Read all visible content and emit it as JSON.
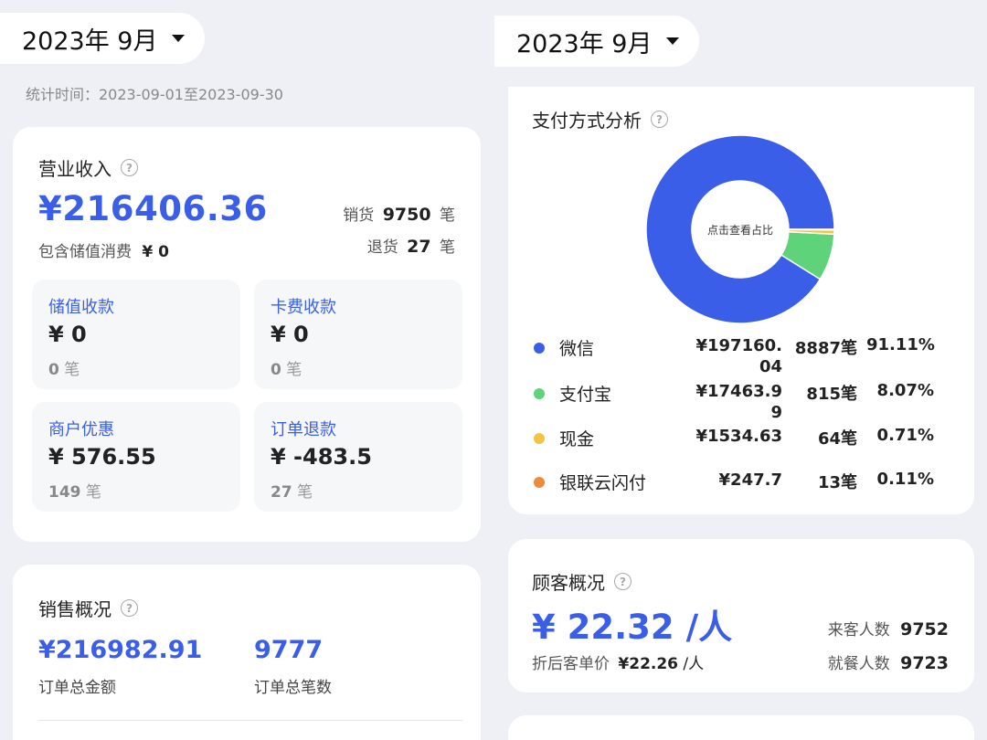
{
  "left_month": {
    "label": "2023年 9月"
  },
  "right_month": {
    "label": "2023年 9月"
  },
  "period": "统计时间：2023-09-01至2023-09-30",
  "revenue": {
    "title": "营业收入",
    "amount": "¥216406.36",
    "stored_label": "包含储值消费",
    "stored_value": "¥ 0",
    "sales_label": "销货",
    "sales_count": "9750",
    "refund_label": "退货",
    "refund_count": "27",
    "unit": "笔",
    "cards": [
      {
        "title": "储值收款",
        "value": "¥ 0",
        "count": "0",
        "unit": "笔"
      },
      {
        "title": "卡费收款",
        "value": "¥ 0",
        "count": "0",
        "unit": "笔"
      },
      {
        "title": "商户优惠",
        "value": "¥ 576.55",
        "count": "149",
        "unit": "笔"
      },
      {
        "title": "订单退款",
        "value": "¥ -483.5",
        "count": "27",
        "unit": "笔"
      }
    ]
  },
  "sales_overview": {
    "title": "销售概况",
    "total_amount": "¥216982.91",
    "total_amount_label": "订单总金额",
    "total_orders": "9777",
    "total_orders_label": "订单总笔数"
  },
  "payment": {
    "title": "支付方式分析",
    "center_text": "点击查看占比",
    "colors": {
      "wechat": "#3b5ee8",
      "alipay": "#5fd37a",
      "cash": "#f5c343",
      "unionpay": "#ee8a3a"
    },
    "rows": [
      {
        "name": "微信",
        "amount_l1": "¥197160.",
        "amount_l2": "04",
        "count": "8887笔",
        "pct": "91.11%",
        "color": "#3b5ee8"
      },
      {
        "name": "支付宝",
        "amount_l1": "¥17463.9",
        "amount_l2": "9",
        "count": "815笔",
        "pct": "8.07%",
        "color": "#5fd37a"
      },
      {
        "name": "现金",
        "amount_l1": "¥1534.63",
        "amount_l2": "",
        "count": "64笔",
        "pct": "0.71%",
        "color": "#f5c343"
      },
      {
        "name": "银联云闪付",
        "amount_l1": "¥247.7",
        "amount_l2": "",
        "count": "13笔",
        "pct": "0.11%",
        "color": "#ee8a3a"
      }
    ]
  },
  "chart_data": {
    "type": "pie",
    "categories": [
      "微信",
      "支付宝",
      "现金",
      "银联云闪付"
    ],
    "values": [
      91.11,
      8.07,
      0.71,
      0.11
    ],
    "title": "支付方式分析"
  },
  "customer": {
    "title": "顾客概况",
    "avg_price": "¥ 22.32",
    "per_person": "/人",
    "after_discount_label": "折后客单价",
    "after_discount_value": "¥22.26",
    "after_discount_unit": "/人",
    "visitors_label": "来客人数",
    "visitors_value": "9752",
    "diners_label": "就餐人数",
    "diners_value": "9723"
  }
}
